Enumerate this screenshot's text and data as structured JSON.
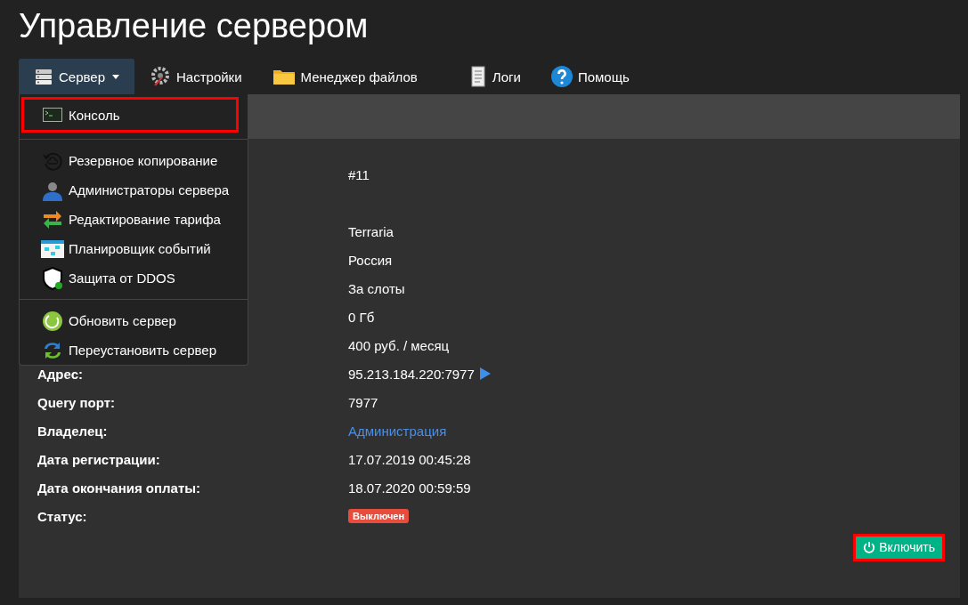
{
  "page_title": "Управление сервером",
  "tabs": [
    {
      "label": "Сервер",
      "selected": true
    },
    {
      "label": "Настройки",
      "selected": false
    },
    {
      "label": "Менеджер файлов",
      "selected": false
    },
    {
      "label": "Логи",
      "selected": false
    },
    {
      "label": "Помощь",
      "selected": false
    }
  ],
  "dropdown": {
    "groups": [
      [
        {
          "label": "Консоль",
          "highlighted": true
        }
      ],
      [
        {
          "label": "Резервное копирование",
          "highlighted": false
        },
        {
          "label": "Администраторы сервера",
          "highlighted": false
        },
        {
          "label": "Редактирование тарифа",
          "highlighted": false
        },
        {
          "label": "Планировщик событий",
          "highlighted": false
        },
        {
          "label": "Защита от DDOS",
          "highlighted": false
        }
      ],
      [
        {
          "label": "Обновить сервер",
          "highlighted": false
        },
        {
          "label": "Переустановить сервер",
          "highlighted": false
        }
      ]
    ]
  },
  "info_rows": [
    {
      "value": "#11",
      "kind": "text"
    },
    {
      "value": "Terraria",
      "kind": "text"
    },
    {
      "value": "Россия",
      "kind": "text"
    },
    {
      "value": "За слоты",
      "kind": "text"
    },
    {
      "value": "0 Гб",
      "kind": "text"
    },
    {
      "value": "400 руб. / месяц",
      "kind": "text"
    },
    {
      "label": "Адрес:",
      "value": "95.213.184.220:7977",
      "kind": "address"
    },
    {
      "label": "Query порт:",
      "value": "7977",
      "kind": "text"
    },
    {
      "label": "Владелец:",
      "value": "Администрация",
      "kind": "link"
    },
    {
      "label": "Дата регистрации:",
      "value": "17.07.2019 00:45:28",
      "kind": "text"
    },
    {
      "label": "Дата окончания оплаты:",
      "value": "18.07.2020 00:59:59",
      "kind": "text"
    },
    {
      "label": "Статус:",
      "value": "Выключен",
      "kind": "badge"
    }
  ],
  "start_button": {
    "label": "Включить",
    "highlighted": true
  }
}
